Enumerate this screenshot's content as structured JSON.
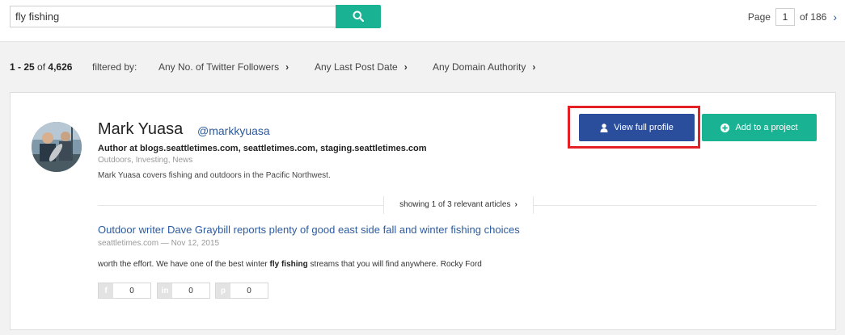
{
  "search": {
    "value": "fly fishing"
  },
  "pager": {
    "page_label": "Page",
    "current_page": "1",
    "of_text": "of 186",
    "next_icon": "chevron-right-icon"
  },
  "results": {
    "range": "1 - 25",
    "of": "of",
    "total": "4,626",
    "filtered_by": "filtered by:"
  },
  "filters": [
    {
      "label": "Any No. of Twitter Followers"
    },
    {
      "label": "Any Last Post Date"
    },
    {
      "label": "Any Domain Authority"
    }
  ],
  "profile": {
    "name": "Mark Yuasa",
    "handle": "@markkyuasa",
    "author_line": "Author at blogs.seattletimes.com, seattletimes.com, staging.seattletimes.com",
    "tags": "Outdoors, Investing, News",
    "bio": "Mark Yuasa covers fishing and outdoors in the Pacific Northwest.",
    "view_button": "View full profile",
    "add_button": "Add to a project"
  },
  "articles_toggle": {
    "label": "showing 1 of 3 relevant articles"
  },
  "article": {
    "title": "Outdoor writer Dave Graybill reports plenty of good east side fall and winter fishing choices",
    "meta": "seattletimes.com — Nov 12, 2015",
    "snippet_before": "worth the effort. We have one of the best winter ",
    "snippet_bold": "fly fishing",
    "snippet_after": " streams that you will find anywhere. Rocky Ford"
  },
  "social": [
    {
      "icon": "facebook-icon",
      "glyph": "f",
      "count": "0"
    },
    {
      "icon": "linkedin-icon",
      "glyph": "in",
      "count": "0"
    },
    {
      "icon": "pinterest-icon",
      "glyph": "p",
      "count": "0"
    }
  ],
  "colors": {
    "primary": "#2a4e9c",
    "accent": "#19b394",
    "highlight": "#e41f26",
    "link": "#2c5aa0"
  }
}
